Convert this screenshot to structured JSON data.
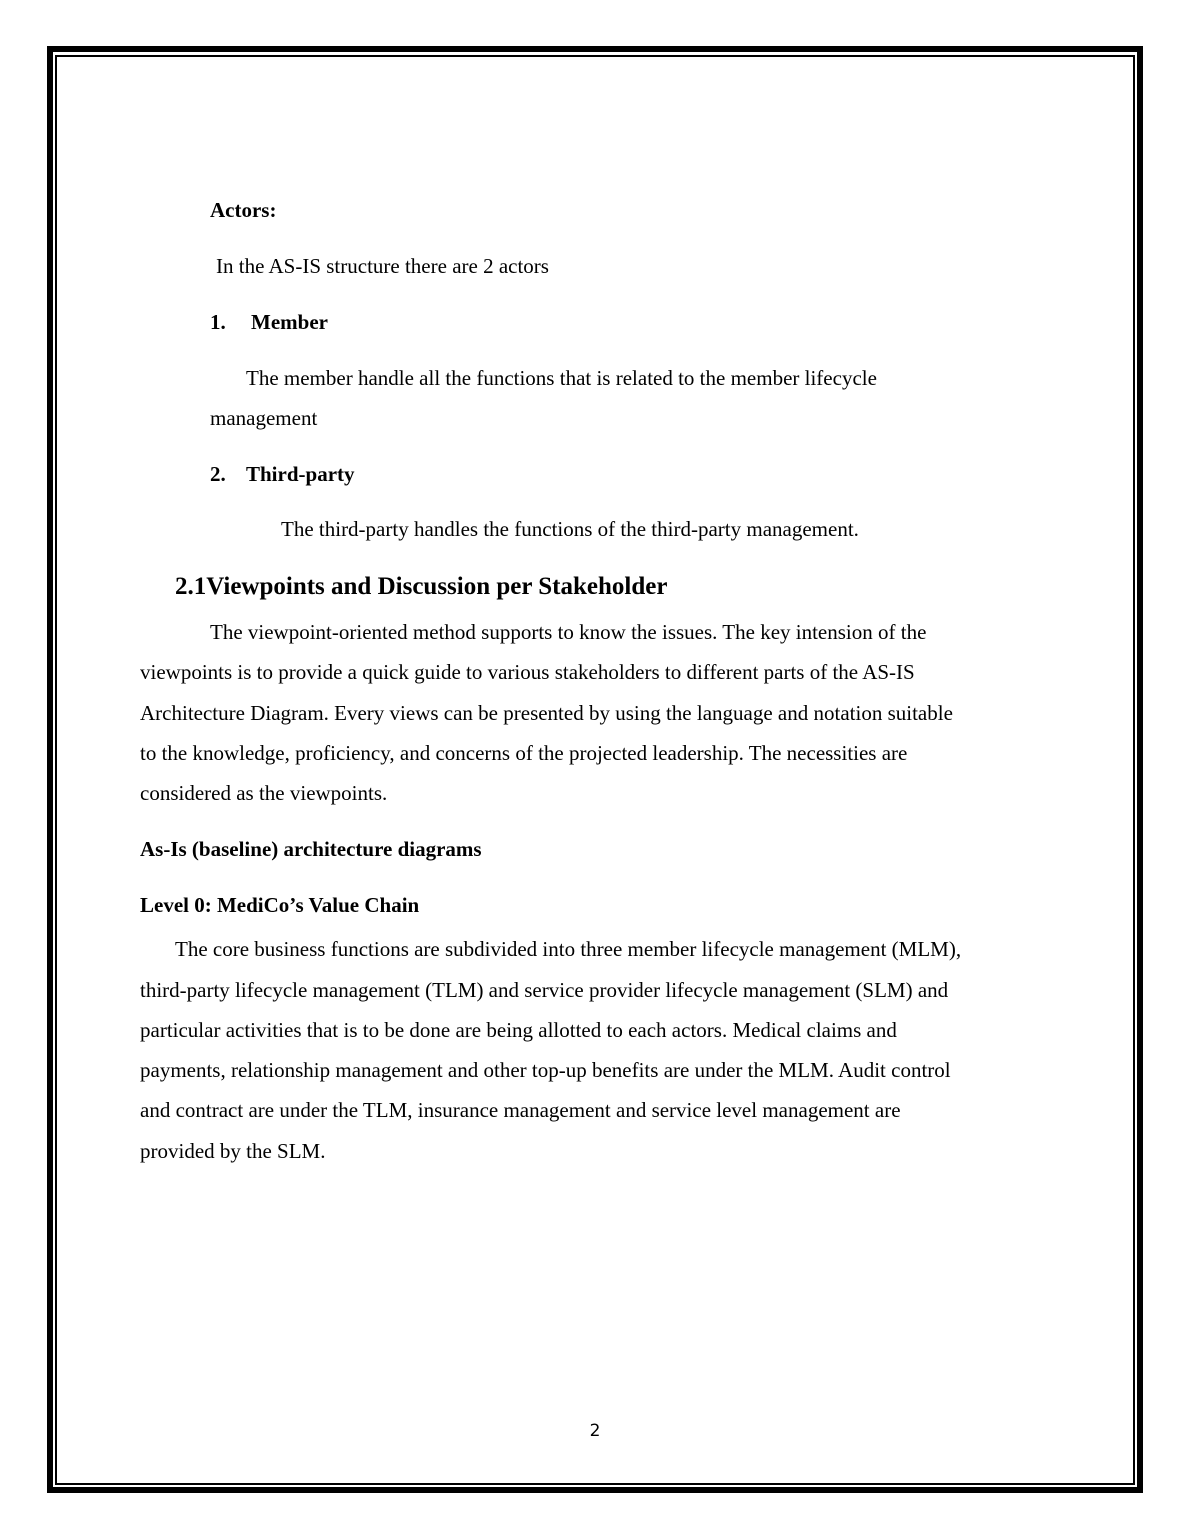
{
  "page": {
    "page_number": "2"
  },
  "actors_section": {
    "heading": "Actors:",
    "intro": "In the AS-IS structure there are 2 actors",
    "items": [
      {
        "number": "1.",
        "title": "Member",
        "description_lines": [
          "The member handle all the functions that is related to the member lifecycle",
          "management"
        ]
      },
      {
        "number": "2.",
        "title": "Third-party",
        "description_lines": [
          "The third-party handles the functions of the third-party management."
        ]
      }
    ]
  },
  "viewpoints_section": {
    "number": "2.1",
    "title": "Viewpoints and Discussion per Stakeholder",
    "paragraph_lines": [
      "The viewpoint-oriented method supports to know the issues. The key intension of the",
      "viewpoints is to provide a quick guide to various stakeholders to different parts of the AS-IS",
      "Architecture Diagram. Every views can be presented by using the language and notation suitable",
      "to the knowledge, proficiency, and concerns of the projected leadership. The necessities are",
      "considered as the viewpoints."
    ]
  },
  "as_is_section": {
    "heading": "As-Is (baseline) architecture diagrams",
    "subheading": "Level 0: MediCo’s Value Chain",
    "paragraph_lines": [
      "The core business functions are subdivided into three member lifecycle management (MLM),",
      "third-party lifecycle management (TLM) and service provider lifecycle management (SLM) and",
      "particular activities that is to be done are being allotted to each actors. Medical claims and",
      "payments, relationship management and other top-up benefits are under the MLM. Audit control",
      "and contract are under the TLM, insurance management and service level management are",
      "provided by the SLM."
    ]
  }
}
